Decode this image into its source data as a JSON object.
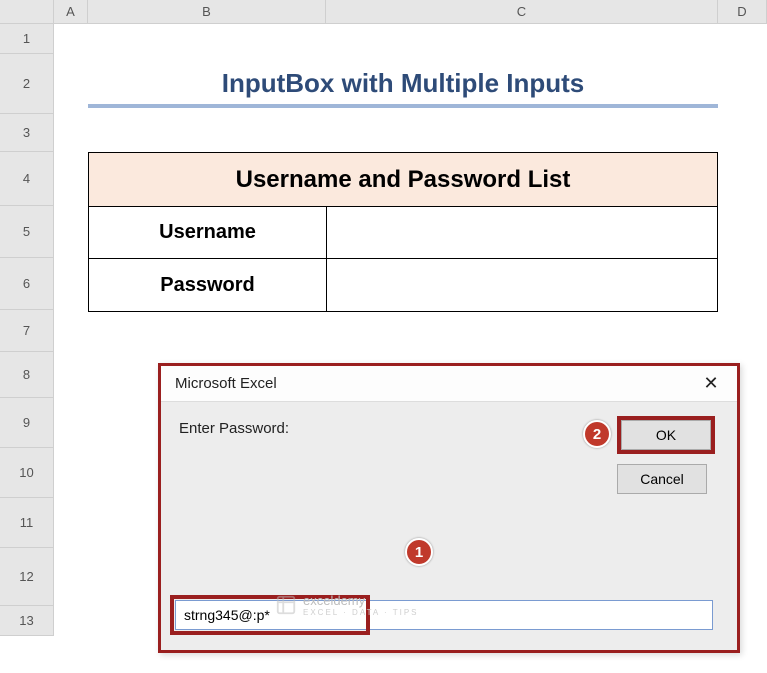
{
  "columns": {
    "A": "A",
    "B": "B",
    "C": "C",
    "D": "D"
  },
  "rows": {
    "1": "1",
    "2": "2",
    "3": "3",
    "4": "4",
    "5": "5",
    "6": "6",
    "7": "7",
    "8": "8",
    "9": "9",
    "10": "10",
    "11": "11",
    "12": "12",
    "13": "13"
  },
  "title": "InputBox with Multiple Inputs",
  "table": {
    "header": "Username and Password List",
    "rows": [
      {
        "label": "Username",
        "value": ""
      },
      {
        "label": "Password",
        "value": ""
      }
    ]
  },
  "dialog": {
    "title": "Microsoft Excel",
    "close_glyph": "✕",
    "prompt": "Enter Password:",
    "ok_label": "OK",
    "cancel_label": "Cancel",
    "input_value": "strng345@:p*"
  },
  "callouts": {
    "one": "1",
    "two": "2"
  },
  "watermark": {
    "name": "exceldemy",
    "sub": "EXCEL · DATA · TIPS"
  }
}
